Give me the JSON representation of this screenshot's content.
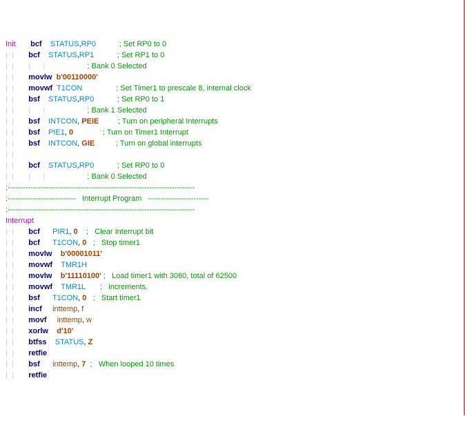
{
  "lines": [
    {
      "i": 0,
      "g": "",
      "col0": {
        "t": "Init",
        "k": "label"
      },
      "mnem": "bcf",
      "r1": {
        "t": "STATUS",
        "k": "reg"
      },
      "sep": ",",
      "r2": {
        "t": "RP0",
        "k": "reg"
      },
      "pad": "           ",
      "cmt": "; Set RP0 to 0"
    },
    {
      "i": 1,
      "g": "|  |       ",
      "mnem": "bcf",
      "r1": {
        "t": "STATUS",
        "k": "reg"
      },
      "sep": ",",
      "r2": {
        "t": "RP1",
        "k": "reg"
      },
      "pad": "           ",
      "cmt": "; Set RP1 to 0"
    },
    {
      "i": 2,
      "g": "|  |       |      |                    ",
      "cmt": "; Bank 0 Selected"
    },
    {
      "i": 3,
      "g": "|  |       ",
      "mnem": "movlw",
      "r1": {
        "t": "b'00110000'",
        "k": "bin"
      }
    },
    {
      "i": 4,
      "g": "|  |       ",
      "mnem": "movwf",
      "r1": {
        "t": "T1CON",
        "k": "reg"
      },
      "pad": "                ",
      "cmt": "; Set Timer1 to prescale 8, internal clock"
    },
    {
      "i": 5,
      "g": ""
    },
    {
      "i": 6,
      "g": "|  |       ",
      "mnem": "bsf",
      "r1": {
        "t": "STATUS",
        "k": "reg"
      },
      "sep": ",",
      "r2": {
        "t": "RP0",
        "k": "reg"
      },
      "pad": "           ",
      "cmt": "; Set RP0 to 1"
    },
    {
      "i": 7,
      "g": "|  |       |      |                    ",
      "cmt": "; Bank 1 Selected"
    },
    {
      "i": 8,
      "g": "|  |       ",
      "mnem": "bsf",
      "r1": {
        "t": "INTCON",
        "k": "reg"
      },
      "sep": ", ",
      "r2": {
        "t": "PEIE",
        "k": "const"
      },
      "pad": "         ",
      "cmt": "; Turn on peripheral Interrupts"
    },
    {
      "i": 9,
      "g": "|  |       ",
      "mnem": "bsf",
      "r1": {
        "t": "PIE1",
        "k": "reg"
      },
      "sep": ", ",
      "r2": {
        "t": "0",
        "k": "const"
      },
      "pad": "              ",
      "cmt": "; Turn on Timer1 Interrupt"
    },
    {
      "i": 10,
      "g": "|  |       ",
      "mnem": "bsf",
      "r1": {
        "t": "INTCON",
        "k": "reg"
      },
      "sep": ", ",
      "r2": {
        "t": "GIE",
        "k": "const"
      },
      "pad": "          ",
      "cmt": "; Turn on global interrupts"
    },
    {
      "i": 11,
      "g": "|  |"
    },
    {
      "i": 12,
      "g": "|  |       ",
      "mnem": "bcf",
      "r1": {
        "t": "STATUS",
        "k": "reg"
      },
      "sep": ",",
      "r2": {
        "t": "RP0",
        "k": "reg"
      },
      "pad": "           ",
      "cmt": "; Set RP0 to 0"
    },
    {
      "i": 13,
      "g": "|  |       |      |                    ",
      "cmt": "; Bank 0 Selected"
    },
    {
      "i": 14,
      "g": ""
    },
    {
      "i": 15,
      "full": ";--------------------------------------------------------------------------",
      "k": "cmtline"
    },
    {
      "i": 16,
      "full": ";---------------------------   Interrupt Program   ------------------------",
      "k": "cmtline"
    },
    {
      "i": 17,
      "full": ";--------------------------------------------------------------------------",
      "k": "cmtline"
    },
    {
      "i": 18,
      "g": "",
      "col0": {
        "t": "Interrupt",
        "k": "label"
      }
    },
    {
      "i": 19,
      "g": "|  |       ",
      "mnem": "bcf",
      "mpad": "      ",
      "r1": {
        "t": "PIR1",
        "k": "reg"
      },
      "sep": ", ",
      "r2": {
        "t": "0",
        "k": "const"
      },
      "pad": "    ",
      "cmt": ";   Clear Interrupt bit"
    },
    {
      "i": 20,
      "g": "|  |       ",
      "mnem": "bcf",
      "mpad": "      ",
      "r1": {
        "t": "T1CON",
        "k": "reg"
      },
      "sep": ", ",
      "r2": {
        "t": "0",
        "k": "const"
      },
      "pad": "   ",
      "cmt": ";   Stop timer1"
    },
    {
      "i": 21,
      "g": "|  |       ",
      "mnem": "movlw",
      "mpad": "    ",
      "r1": {
        "t": "b'00001011'",
        "k": "bin"
      }
    },
    {
      "i": 22,
      "g": "|  |       ",
      "mnem": "movwf",
      "mpad": "    ",
      "r1": {
        "t": "TMR1H",
        "k": "reg"
      }
    },
    {
      "i": 23,
      "g": "|  |       ",
      "mnem": "movlw",
      "mpad": "    ",
      "r1": {
        "t": "b'11110100'",
        "k": "bin"
      },
      "pad": " ",
      "cmt": ";   Load timer1 with 3060, total of 62500"
    },
    {
      "i": 24,
      "g": "|  |       ",
      "mnem": "movwf",
      "mpad": "    ",
      "r1": {
        "t": "TMR1L",
        "k": "reg"
      },
      "pad": "       ",
      "cmt": ";   increments."
    },
    {
      "i": 25,
      "g": "|  |       ",
      "mnem": "bsf",
      "mpad": "      ",
      "r1": {
        "t": "T1CON",
        "k": "reg"
      },
      "sep": ", ",
      "r2": {
        "t": "0",
        "k": "const"
      },
      "pad": "   ",
      "cmt": ";   Start timer1"
    },
    {
      "i": 26,
      "g": "|  |       ",
      "mnem": "incf",
      "mpad": "     ",
      "r1": {
        "t": "inttemp",
        "k": "ident"
      },
      "sep": ", ",
      "r2": {
        "t": "f",
        "k": "ident"
      }
    },
    {
      "i": 27,
      "g": "|  |       ",
      "mnem": "movf",
      "mpad": "     ",
      "r1": {
        "t": "inttemp",
        "k": "ident"
      },
      "sep": ", ",
      "r2": {
        "t": "w",
        "k": "ident"
      }
    },
    {
      "i": 28,
      "g": "|  |       ",
      "mnem": "xorlw",
      "mpad": "    ",
      "r1": {
        "t": "d'10'",
        "k": "bin"
      }
    },
    {
      "i": 29,
      "g": "|  |       ",
      "mnem": "btfss",
      "mpad": "    ",
      "r1": {
        "t": "STATUS",
        "k": "reg"
      },
      "sep": ", ",
      "r2": {
        "t": "Z",
        "k": "const"
      }
    },
    {
      "i": 30,
      "g": "|  |       ",
      "mnem": "retfie"
    },
    {
      "i": 31,
      "g": "|  |       ",
      "mnem": "bsf",
      "mpad": "      ",
      "r1": {
        "t": "inttemp",
        "k": "ident"
      },
      "sep": ", ",
      "r2": {
        "t": "7",
        "k": "const"
      },
      "pad": "  ",
      "cmt": ";   When looped 10 times"
    },
    {
      "i": 32,
      "g": "|  |       ",
      "mnem": "retfie"
    }
  ]
}
